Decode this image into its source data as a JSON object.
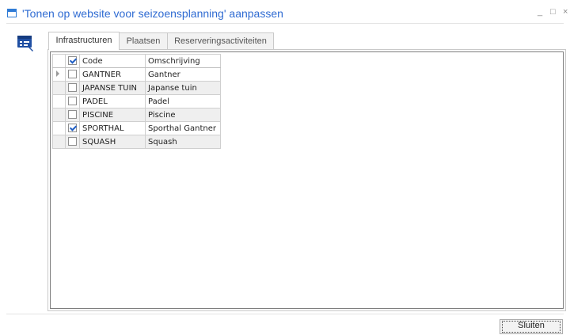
{
  "window": {
    "title": "'Tonen op website voor seizoensplanning' aanpassen",
    "minimize_glyph": "_",
    "maximize_glyph": "□",
    "close_glyph": "×"
  },
  "icons": {
    "app": "form-settings-icon"
  },
  "tabs": [
    {
      "label": "Infrastructuren",
      "active": true
    },
    {
      "label": "Plaatsen",
      "active": false
    },
    {
      "label": "Reserveringsactiviteiten",
      "active": false
    }
  ],
  "grid": {
    "header_checked": true,
    "columns": [
      "Code",
      "Omschrijving"
    ],
    "rows": [
      {
        "checked": false,
        "code": "GANTNER",
        "omschrijving": "Gantner",
        "current": true
      },
      {
        "checked": false,
        "code": "JAPANSE TUIN",
        "omschrijving": "Japanse tuin",
        "current": false
      },
      {
        "checked": false,
        "code": "PADEL",
        "omschrijving": "Padel",
        "current": false
      },
      {
        "checked": false,
        "code": "PISCINE",
        "omschrijving": "Piscine",
        "current": false
      },
      {
        "checked": true,
        "code": "SPORTHAL",
        "omschrijving": "Sporthal Gantner",
        "current": false
      },
      {
        "checked": false,
        "code": "SQUASH",
        "omschrijving": "Squash",
        "current": false
      }
    ]
  },
  "footer": {
    "close_label": "Sluiten"
  }
}
